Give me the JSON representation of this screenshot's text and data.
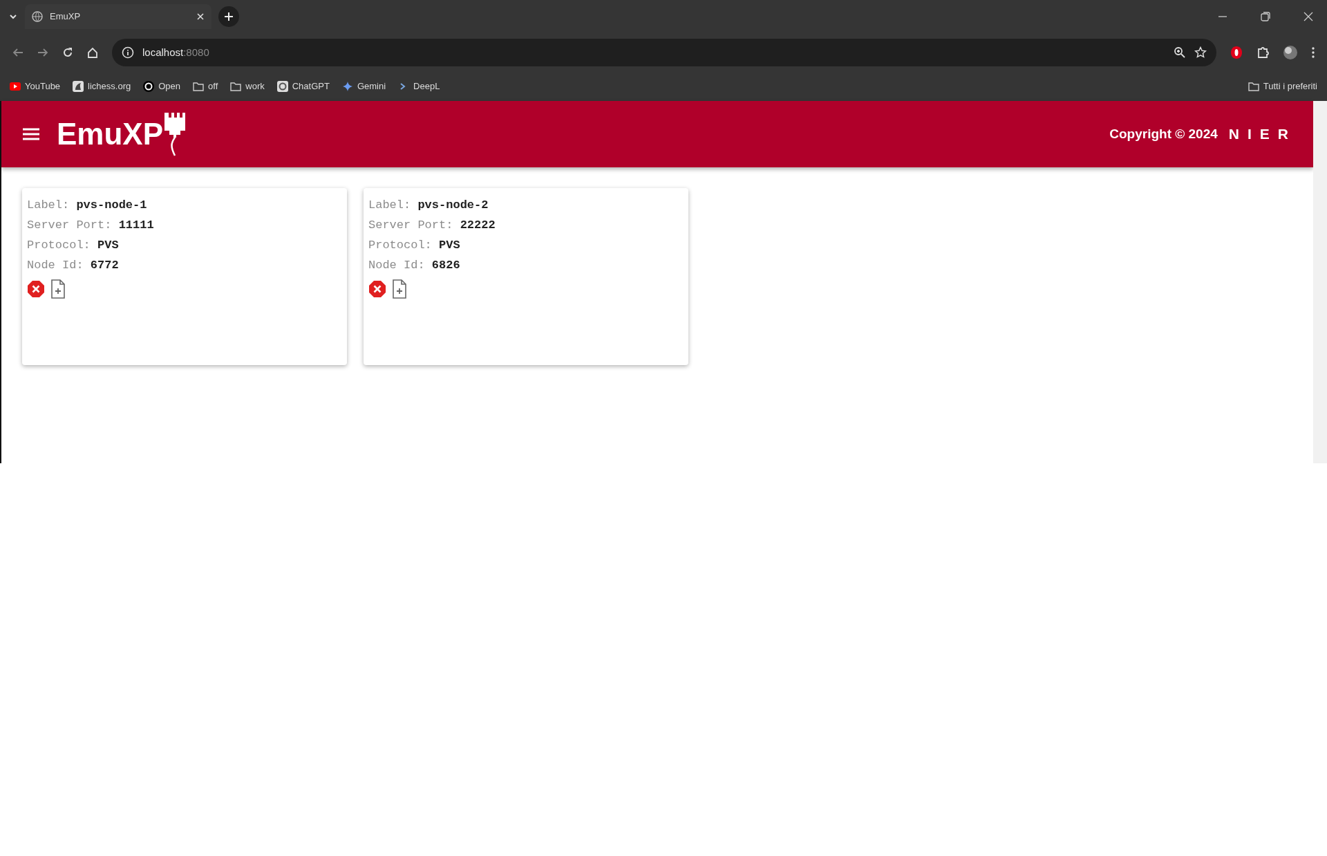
{
  "browser": {
    "tab": {
      "title": "EmuXP"
    },
    "address": {
      "host": "localhost",
      "port": ":8080"
    },
    "bookmarks": [
      {
        "label": "YouTube",
        "kind": "youtube"
      },
      {
        "label": "lichess.org",
        "kind": "lichess"
      },
      {
        "label": "Open",
        "kind": "open"
      },
      {
        "label": "off",
        "kind": "folder"
      },
      {
        "label": "work",
        "kind": "folder"
      },
      {
        "label": "ChatGPT",
        "kind": "chatgpt"
      },
      {
        "label": "Gemini",
        "kind": "gemini"
      },
      {
        "label": "DeepL",
        "kind": "deepl"
      }
    ],
    "all_bookmarks": "Tutti i preferiti"
  },
  "app": {
    "title": "EmuXP",
    "copyright": "Copyright © 2024",
    "brand": "NIER"
  },
  "nodes": [
    {
      "fields": [
        {
          "label": "Label:",
          "value": "pvs-node-1"
        },
        {
          "label": "Server Port:",
          "value": "11111"
        },
        {
          "label": "Protocol:",
          "value": "PVS"
        },
        {
          "label": "Node Id:",
          "value": "6772"
        }
      ]
    },
    {
      "fields": [
        {
          "label": "Label:",
          "value": "pvs-node-2"
        },
        {
          "label": "Server Port:",
          "value": "22222"
        },
        {
          "label": "Protocol:",
          "value": "PVS"
        },
        {
          "label": "Node Id:",
          "value": "6826"
        }
      ]
    }
  ]
}
